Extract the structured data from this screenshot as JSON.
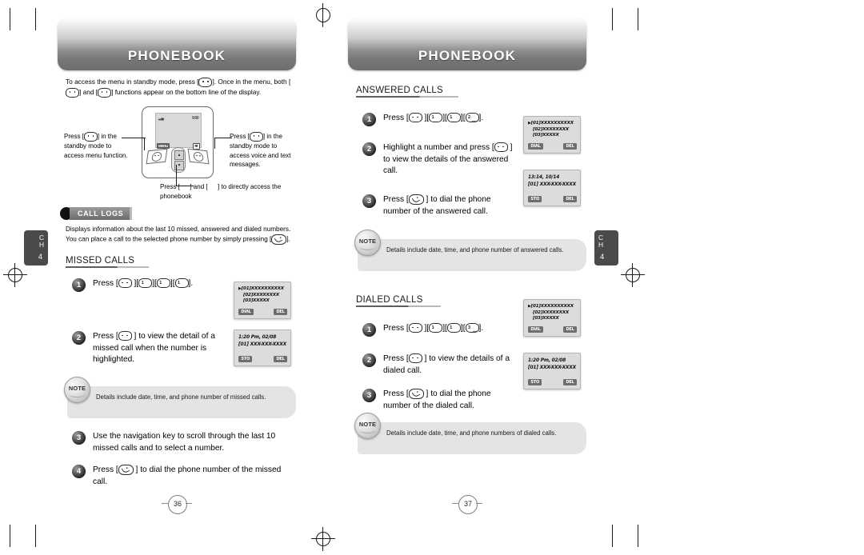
{
  "document": {
    "type": "phone-user-manual-spread",
    "chapter_tab": {
      "line1": "C",
      "line2": "H",
      "number": "4"
    }
  },
  "left_page": {
    "banner_title": "PHONEBOOK",
    "page_number": "36",
    "intro": "To access the menu in standby mode, press [ ·· ]. Once in the menu, both [ ·· ] and [ ·· ] functions appear on the bottom line of the display.",
    "diagram": {
      "lcd_signal": "▂▄",
      "lcd_right": "9:00",
      "softkey_left": "MENU",
      "softkey_right": "envelope-icon",
      "navkey_up": "▲",
      "navkey_down": "▼",
      "callout_left": "Press [ ·· ] in the standby mode to access menu function.",
      "callout_right": "Press [ ·· ] in the standby mode to access voice and text messages.",
      "callout_bottom": "Press [ ▲ ] and [ ▼ ] to directly access the phonebook"
    },
    "call_logs": {
      "badge_label": "CALL LOGS",
      "description": "Displays information about the last 10 missed, answered and dialed numbers. You can place a call to the selected phone number by simply pressing [ ↖ ]."
    },
    "missed_calls": {
      "heading": "MISSED CALLS",
      "steps": [
        {
          "num": "1",
          "text_before": "Press [",
          "keys": [
            "MENU",
            "1",
            "1",
            "1"
          ],
          "text_after": "]."
        },
        {
          "num": "2",
          "text": "Press [ MENU ] to view the detail of a missed call when the number is highlighted."
        },
        {
          "num": "3",
          "text": "Use the navigation key to scroll through the last 10 missed calls and to select a number."
        },
        {
          "num": "4",
          "text": "Press [ SEND ] to dial the phone number of the missed call."
        }
      ],
      "note": "Details include date, time, and phone number of missed calls.",
      "note_badge": "NOTE",
      "screen_list": {
        "lines": [
          "[01]XXXXXXXXXX",
          "[02]XXXXXXXX",
          "[03]XXXXX"
        ],
        "soft_left": "DIAL",
        "soft_right": "DEL"
      },
      "screen_detail": {
        "lines": [
          "1:20 Pm, 02/08",
          "[01]  XXX-XXX-XXXX"
        ],
        "soft_left": "STO",
        "soft_right": "DEL"
      }
    }
  },
  "right_page": {
    "banner_title": "PHONEBOOK",
    "page_number": "37",
    "answered_calls": {
      "heading": "ANSWERED CALLS",
      "steps": [
        {
          "num": "1",
          "text_before": "Press [",
          "keys": [
            "MENU",
            "1",
            "1",
            "2"
          ],
          "text_after": "]."
        },
        {
          "num": "2",
          "text": "Highlight a number and press [ MENU ] to view the details of the answered call."
        },
        {
          "num": "3",
          "text": "Press [ SEND ] to dial the phone number of the answered call."
        }
      ],
      "note": "Details include date, time, and phone number of answered calls.",
      "note_badge": "NOTE",
      "screen_list": {
        "lines": [
          "[01]XXXXXXXXXX",
          "[02]XXXXXXXX",
          "[03]XXXXX"
        ],
        "soft_left": "DIAL",
        "soft_right": "DEL"
      },
      "screen_detail": {
        "lines": [
          "13:14, 10/14",
          "[01]  XXX-XXX-XXXX"
        ],
        "soft_left": "STO",
        "soft_right": "DEL"
      }
    },
    "dialed_calls": {
      "heading": "DIALED CALLS",
      "steps": [
        {
          "num": "1",
          "text_before": "Press [",
          "keys": [
            "MENU",
            "1",
            "1",
            "3"
          ],
          "text_after": "]."
        },
        {
          "num": "2",
          "text": "Press [ MENU ] to view the details of a dialed call."
        },
        {
          "num": "3",
          "text": "Press [ SEND ] to dial the phone number of the dialed call."
        }
      ],
      "note": "Details include date, time, and phone numbers of dialed calls.",
      "note_badge": "NOTE",
      "screen_list": {
        "lines": [
          "[01]XXXXXXXXXX",
          "[02]XXXXXXXX",
          "[03]XXXXX"
        ],
        "soft_left": "DIAL",
        "soft_right": "DEL"
      },
      "screen_detail": {
        "lines": [
          "1:20 Pm, 02/08",
          "[01]  XXX-XXX-XXXX"
        ],
        "soft_left": "STO",
        "soft_right": "DEL"
      }
    }
  },
  "key_glyphs": {
    "menu": "menu-key-icon",
    "one": "1",
    "one_sub": "␣",
    "two": "2",
    "two_sub": "abc",
    "three": "3",
    "three_sub": "def",
    "send": "send-key-icon"
  },
  "colors": {
    "banner_dark": "#6e6e6e",
    "banner_light": "#fdfdfd",
    "lcd_bg": "#dcdcdc",
    "note_bg": "#e4e4e4",
    "tab_bg": "#4a4a4a",
    "badge_gray": "#6c6c6c"
  }
}
